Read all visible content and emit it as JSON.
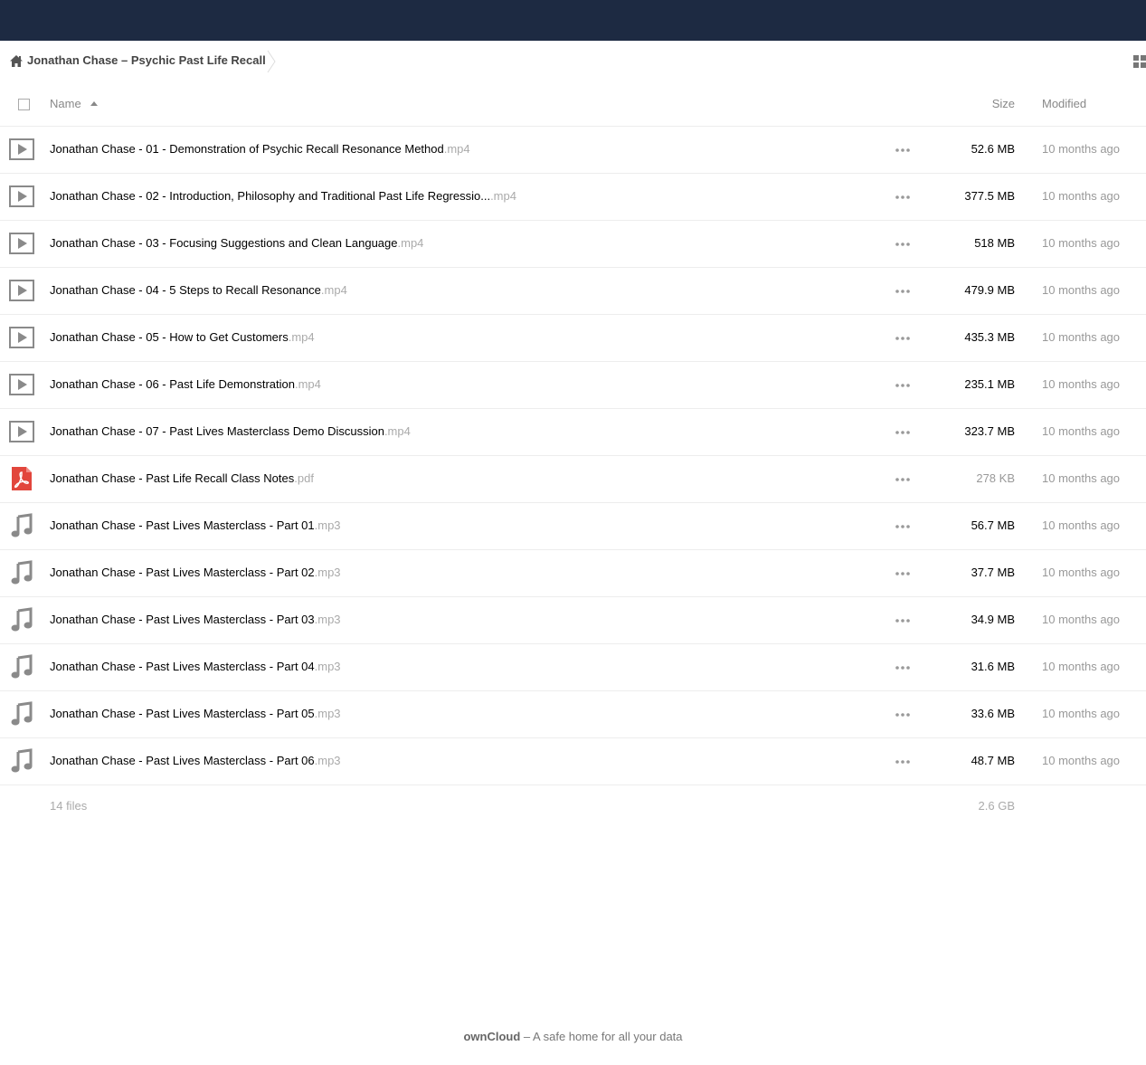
{
  "breadcrumb": {
    "folder": "Jonathan Chase – Psychic Past Life Recall"
  },
  "header": {
    "name": "Name",
    "size": "Size",
    "modified": "Modified"
  },
  "files": [
    {
      "type": "video",
      "name": "Jonathan Chase - 01 - Demonstration of Psychic Recall Resonance Method",
      "ext": ".mp4",
      "size": "52.6 MB",
      "modified": "10 months ago"
    },
    {
      "type": "video",
      "name": "Jonathan Chase - 02 - Introduction, Philosophy and Traditional Past Life Regressio...",
      "ext": ".mp4",
      "size": "377.5 MB",
      "modified": "10 months ago"
    },
    {
      "type": "video",
      "name": "Jonathan Chase - 03 - Focusing Suggestions and Clean Language",
      "ext": ".mp4",
      "size": "518 MB",
      "modified": "10 months ago"
    },
    {
      "type": "video",
      "name": "Jonathan Chase - 04 - 5 Steps to Recall Resonance",
      "ext": ".mp4",
      "size": "479.9 MB",
      "modified": "10 months ago"
    },
    {
      "type": "video",
      "name": "Jonathan Chase - 05 - How to Get Customers",
      "ext": ".mp4",
      "size": "435.3 MB",
      "modified": "10 months ago"
    },
    {
      "type": "video",
      "name": "Jonathan Chase - 06 - Past Life Demonstration",
      "ext": ".mp4",
      "size": "235.1 MB",
      "modified": "10 months ago"
    },
    {
      "type": "video",
      "name": "Jonathan Chase - 07 - Past Lives Masterclass Demo Discussion",
      "ext": ".mp4",
      "size": "323.7 MB",
      "modified": "10 months ago"
    },
    {
      "type": "pdf",
      "name": "Jonathan Chase - Past Life Recall Class Notes",
      "ext": ".pdf",
      "size": "278 KB",
      "modified": "10 months ago"
    },
    {
      "type": "audio",
      "name": "Jonathan Chase - Past Lives Masterclass - Part 01",
      "ext": ".mp3",
      "size": "56.7 MB",
      "modified": "10 months ago"
    },
    {
      "type": "audio",
      "name": "Jonathan Chase - Past Lives Masterclass - Part 02",
      "ext": ".mp3",
      "size": "37.7 MB",
      "modified": "10 months ago"
    },
    {
      "type": "audio",
      "name": "Jonathan Chase - Past Lives Masterclass - Part 03",
      "ext": ".mp3",
      "size": "34.9 MB",
      "modified": "10 months ago"
    },
    {
      "type": "audio",
      "name": "Jonathan Chase - Past Lives Masterclass - Part 04",
      "ext": ".mp3",
      "size": "31.6 MB",
      "modified": "10 months ago"
    },
    {
      "type": "audio",
      "name": "Jonathan Chase - Past Lives Masterclass - Part 05",
      "ext": ".mp3",
      "size": "33.6 MB",
      "modified": "10 months ago"
    },
    {
      "type": "audio",
      "name": "Jonathan Chase - Past Lives Masterclass - Part 06",
      "ext": ".mp3",
      "size": "48.7 MB",
      "modified": "10 months ago"
    }
  ],
  "summary": {
    "files": "14 files",
    "size": "2.6 GB"
  },
  "footer": {
    "brand": "ownCloud",
    "tagline": " – A safe home for all your data"
  },
  "colors": {
    "topbar": "#1d2a42",
    "pdf": "#e2463c",
    "icon_gray": "#8a8a8a"
  }
}
